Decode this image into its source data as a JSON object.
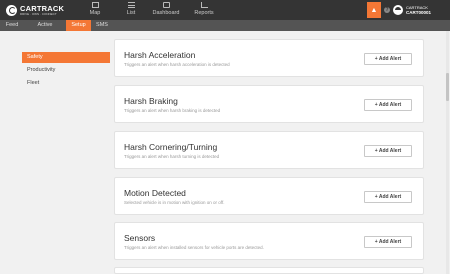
{
  "app": {
    "logo_text": "CARTRACK",
    "logo_tagline": "DRIVE · OWN · CONNECT"
  },
  "topnav": [
    {
      "label": "Map",
      "icon": "map-icon"
    },
    {
      "label": "List",
      "icon": "list-icon"
    },
    {
      "label": "Dashboard",
      "icon": "dashboard-icon"
    },
    {
      "label": "Reports",
      "icon": "reports-icon"
    }
  ],
  "account": {
    "company": "CARTRACK",
    "code": "CART00001"
  },
  "subnav": [
    {
      "label": "Feed"
    },
    {
      "label": "Active"
    },
    {
      "label": "Setup",
      "active": true
    },
    {
      "label": "SMS"
    }
  ],
  "sidebar": [
    {
      "label": "Safety",
      "active": true
    },
    {
      "label": "Productivity"
    },
    {
      "label": "Fleet"
    }
  ],
  "cards": [
    {
      "title": "Harsh Acceleration",
      "description": "Triggers an alert when harsh acceleration is detected",
      "button": "+ Add Alert"
    },
    {
      "title": "Harsh Braking",
      "description": "Triggers an alert when harsh braking is detected",
      "button": "+ Add Alert"
    },
    {
      "title": "Harsh Cornering/Turning",
      "description": "Triggers an alert when harsh turning is detected",
      "button": "+ Add Alert"
    },
    {
      "title": "Motion Detected",
      "description": "Selected vehicle is in motion with ignition on or off.",
      "button": "+ Add Alert"
    },
    {
      "title": "Sensors",
      "description": "Triggers an alert when installed sensors for vehicle ports are detected.",
      "button": "+ Add Alert"
    }
  ],
  "colors": {
    "accent": "#f47735",
    "topbar": "#343434",
    "subnav": "#545454",
    "background": "#f1f1f1"
  }
}
